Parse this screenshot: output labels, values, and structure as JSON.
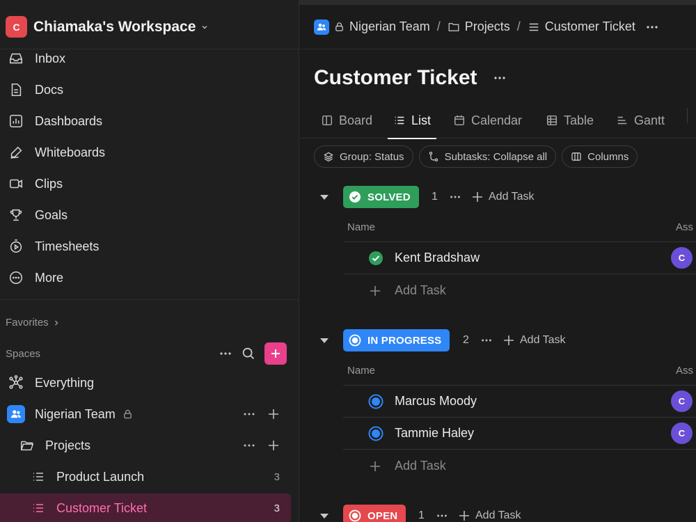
{
  "colors": {
    "workspace_logo": "#e5484d",
    "accent_pink": "#e8408a",
    "space_blue": "#2f86f6",
    "solved": "#2f9e5b",
    "in_progress": "#2f86f6",
    "open": "#e5484d",
    "avatar": "#6b4fd8"
  },
  "workspace": {
    "logo_letter": "C",
    "name": "Chiamaka's Workspace"
  },
  "sidebar": {
    "nav": [
      {
        "label": "Inbox",
        "icon": "inbox-icon"
      },
      {
        "label": "Docs",
        "icon": "doc-icon"
      },
      {
        "label": "Dashboards",
        "icon": "dashboard-icon"
      },
      {
        "label": "Whiteboards",
        "icon": "whiteboard-icon"
      },
      {
        "label": "Clips",
        "icon": "video-icon"
      },
      {
        "label": "Goals",
        "icon": "trophy-icon"
      },
      {
        "label": "Timesheets",
        "icon": "timer-icon"
      },
      {
        "label": "More",
        "icon": "more-circle-icon"
      }
    ],
    "favorites_label": "Favorites",
    "spaces_label": "Spaces",
    "tree": {
      "everything": "Everything",
      "space": "Nigerian Team",
      "folder": "Projects",
      "lists": [
        {
          "label": "Product Launch",
          "count": "3"
        },
        {
          "label": "Customer Ticket",
          "count": "3"
        }
      ]
    }
  },
  "breadcrumb": {
    "space": "Nigerian Team",
    "sep1": "/",
    "folder": "Projects",
    "sep2": "/",
    "list": "Customer Ticket"
  },
  "page": {
    "title": "Customer Ticket"
  },
  "tabs": [
    {
      "label": "Board",
      "icon": "board-icon"
    },
    {
      "label": "List",
      "icon": "list-icon"
    },
    {
      "label": "Calendar",
      "icon": "calendar-icon"
    },
    {
      "label": "Table",
      "icon": "table-icon"
    },
    {
      "label": "Gantt",
      "icon": "gantt-icon"
    }
  ],
  "filters": {
    "group": "Group: Status",
    "subtasks": "Subtasks: Collapse all",
    "columns": "Columns"
  },
  "groups": [
    {
      "status": "SOLVED",
      "count": "1",
      "add_label": "Add Task",
      "col_name": "Name",
      "col_assignee": "Ass",
      "tasks": [
        {
          "name": "Kent Bradshaw",
          "assignee": "C"
        }
      ],
      "add_row": "Add Task"
    },
    {
      "status": "IN PROGRESS",
      "count": "2",
      "add_label": "Add Task",
      "col_name": "Name",
      "col_assignee": "Ass",
      "tasks": [
        {
          "name": "Marcus Moody",
          "assignee": "C"
        },
        {
          "name": "Tammie Haley",
          "assignee": "C"
        }
      ],
      "add_row": "Add Task"
    },
    {
      "status": "OPEN",
      "count": "1",
      "add_label": "Add Task"
    }
  ]
}
